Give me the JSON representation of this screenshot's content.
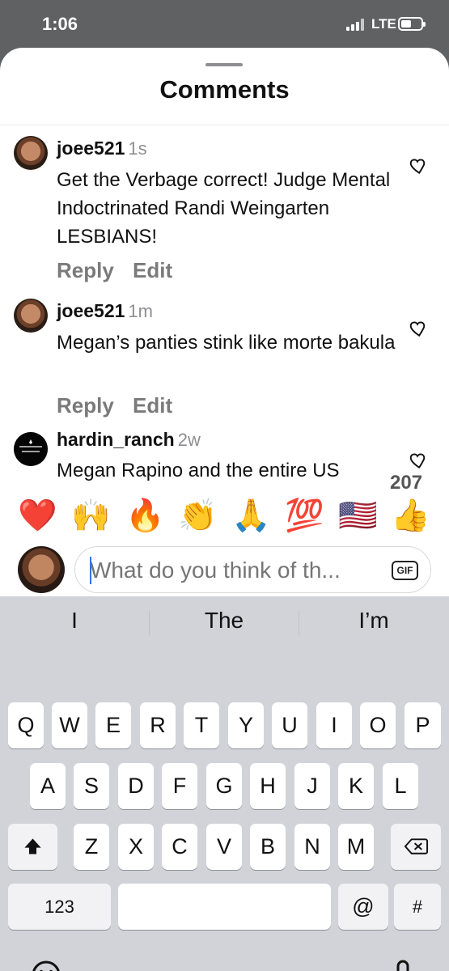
{
  "status_bar": {
    "time": "1:06",
    "network": "LTE"
  },
  "sheet": {
    "title": "Comments"
  },
  "comments": [
    {
      "username": "joee521",
      "time": "1s",
      "text": "Get the Verbage correct! Judge Mental Indoctrinated Randi Weingarten LESBIANS!",
      "actions": [
        "Reply",
        "Edit"
      ]
    },
    {
      "username": "joee521",
      "time": "1m",
      "text": "Megan’s panties stink like morte bakula",
      "actions": [
        "Reply",
        "Edit"
      ]
    },
    {
      "username": "hardin_ranch",
      "time": "2w",
      "text": "Megan Rapino and the entire US",
      "partial_right": "207",
      "actions": []
    }
  ],
  "emoji_reactions": [
    "❤️",
    "🙌",
    "🔥",
    "👏",
    "🙏",
    "💯",
    "🇺🇸",
    "👍"
  ],
  "composer": {
    "placeholder": "What do you think of th...",
    "gif_label": "GIF"
  },
  "keyboard": {
    "suggestions": [
      "I",
      "The",
      "I’m"
    ],
    "row1": [
      "Q",
      "W",
      "E",
      "R",
      "T",
      "Y",
      "U",
      "I",
      "O",
      "P"
    ],
    "row2": [
      "A",
      "S",
      "D",
      "F",
      "G",
      "H",
      "J",
      "K",
      "L"
    ],
    "row3": [
      "Z",
      "X",
      "C",
      "V",
      "B",
      "N",
      "M"
    ],
    "numbers_key": "123",
    "at_key": "@",
    "hash_key": "#"
  },
  "colors": {
    "status_bar": "#5f6163",
    "keyboard": "#d1d3d9",
    "caret": "#2f73ea"
  },
  "icons": {
    "heart": "heart-icon",
    "shift": "shift-icon",
    "backspace": "backspace-icon",
    "emoji": "emoji-keyboard-icon",
    "microphone": "microphone-icon"
  }
}
